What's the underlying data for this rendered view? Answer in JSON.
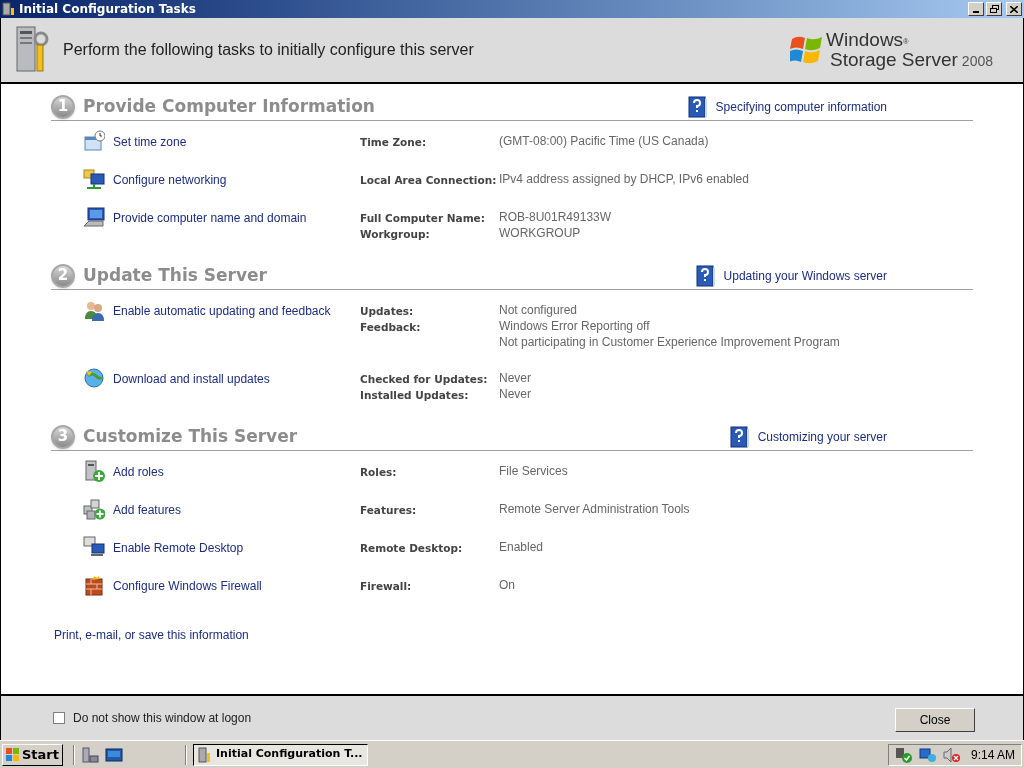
{
  "window": {
    "title": "Initial Configuration Tasks"
  },
  "header": {
    "text": "Perform the following tasks to initially configure this server",
    "logo_line_1": "Windows",
    "logo_mark": "®",
    "logo_line_2": "Storage Server",
    "logo_year": "2008"
  },
  "sections": [
    {
      "number": "1",
      "title": "Provide Computer Information",
      "help": "Specifying computer information",
      "tasks": [
        {
          "kind": "timezone",
          "link": "Set time zone",
          "fields": [
            {
              "label": "Time Zone:",
              "values": [
                "(GMT-08:00) Pacific Time (US  Canada)"
              ]
            }
          ]
        },
        {
          "kind": "network",
          "link": "Configure networking",
          "fields": [
            {
              "label": "Local Area Connection:",
              "values": [
                "IPv4 address assigned by DHCP, IPv6 enabled"
              ]
            }
          ]
        },
        {
          "kind": "computer",
          "link": "Provide computer name and domain",
          "fields": [
            {
              "label": "Full Computer Name:",
              "values": [
                "ROB-8U01R49133W"
              ]
            },
            {
              "label": "Workgroup:",
              "values": [
                "WORKGROUP"
              ]
            }
          ]
        }
      ]
    },
    {
      "number": "2",
      "title": "Update This Server",
      "help": "Updating your Windows server",
      "tasks": [
        {
          "kind": "feedback",
          "link": "Enable automatic updating and feedback",
          "fields": [
            {
              "label": "Updates:",
              "values": [
                "Not configured"
              ]
            },
            {
              "label": "Feedback:",
              "values": [
                "Windows Error Reporting off",
                "Not participating in Customer Experience Improvement Program"
              ]
            }
          ]
        },
        {
          "kind": "updates",
          "link": "Download and install updates",
          "fields": [
            {
              "label": "Checked for Updates:",
              "values": [
                "Never"
              ]
            },
            {
              "label": "Installed Updates:",
              "values": [
                "Never"
              ]
            }
          ]
        }
      ]
    },
    {
      "number": "3",
      "title": "Customize This Server",
      "help": "Customizing your server",
      "tasks": [
        {
          "kind": "roles",
          "link": "Add roles",
          "fields": [
            {
              "label": "Roles:",
              "values": [
                "File Services"
              ]
            }
          ]
        },
        {
          "kind": "features",
          "link": "Add features",
          "fields": [
            {
              "label": "Features:",
              "values": [
                "Remote Server Administration Tools"
              ]
            }
          ]
        },
        {
          "kind": "remote",
          "link": "Enable Remote Desktop",
          "fields": [
            {
              "label": "Remote Desktop:",
              "values": [
                "Enabled"
              ]
            }
          ]
        },
        {
          "kind": "firewall",
          "link": "Configure Windows Firewall",
          "fields": [
            {
              "label": "Firewall:",
              "values": [
                "On"
              ]
            }
          ]
        }
      ]
    }
  ],
  "print_link": "Print, e-mail, or save this information",
  "footer": {
    "checkbox": {
      "label": "Do not show this window at logon",
      "checked": false
    },
    "close_button": "Close"
  },
  "taskbar": {
    "start": "Start",
    "tasks": [
      {
        "label": "Initial Configuration T...",
        "selected": true
      }
    ],
    "clock": "9:14 AM"
  }
}
